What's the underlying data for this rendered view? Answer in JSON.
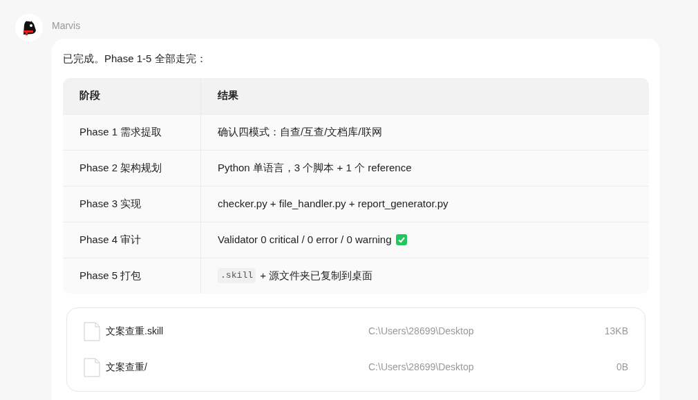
{
  "message": {
    "sender": "Marvis",
    "intro": "已完成。Phase 1-5 全部走完：",
    "table": {
      "columns": [
        "阶段",
        "结果"
      ],
      "rows": [
        {
          "phase": "Phase 1 需求提取",
          "result": [
            {
              "kind": "text",
              "text": "确认四模式：自查/互查/文档库/联网"
            }
          ]
        },
        {
          "phase": "Phase 2 架构规划",
          "result": [
            {
              "kind": "text",
              "text": "Python 单语言，3 个脚本 + 1 个 reference"
            }
          ]
        },
        {
          "phase": "Phase 3 实现",
          "result": [
            {
              "kind": "text",
              "text": "checker.py + file_handler.py + report_generator.py"
            }
          ]
        },
        {
          "phase": "Phase 4 审计",
          "result": [
            {
              "kind": "text",
              "text": "Validator 0 critical / 0 error / 0 warning"
            },
            {
              "kind": "check"
            }
          ]
        },
        {
          "phase": "Phase 5 打包",
          "result": [
            {
              "kind": "code",
              "text": ".skill"
            },
            {
              "kind": "text",
              "text": "+ 源文件夹已复制到桌面"
            }
          ]
        }
      ]
    },
    "files": [
      {
        "name": "文案查重.skill",
        "path": "C:\\Users\\28699\\Desktop",
        "size": "13KB"
      },
      {
        "name": "文案查重/",
        "path": "C:\\Users\\28699\\Desktop",
        "size": "0B"
      }
    ]
  }
}
